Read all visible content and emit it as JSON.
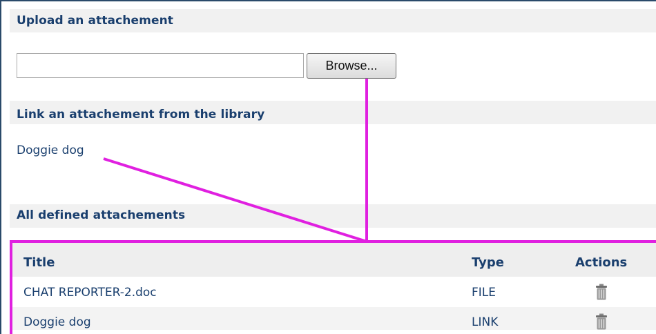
{
  "upload": {
    "title": "Upload an attachement",
    "browse_label": "Browse..."
  },
  "library": {
    "title": "Link an attachement from the library",
    "items": [
      "Doggie dog"
    ]
  },
  "attachments": {
    "title": "All defined attachements",
    "columns": {
      "title": "Title",
      "type": "Type",
      "actions": "Actions"
    },
    "rows": [
      {
        "title": "CHAT REPORTER-2.doc",
        "type": "FILE",
        "action_icon": "trash-icon"
      },
      {
        "title": "Doggie dog",
        "type": "LINK",
        "action_icon": "trash-icon"
      }
    ]
  },
  "colors": {
    "annotation": "#e020e0",
    "heading": "#1a3f6e",
    "header_bg": "#f1f1f1"
  }
}
